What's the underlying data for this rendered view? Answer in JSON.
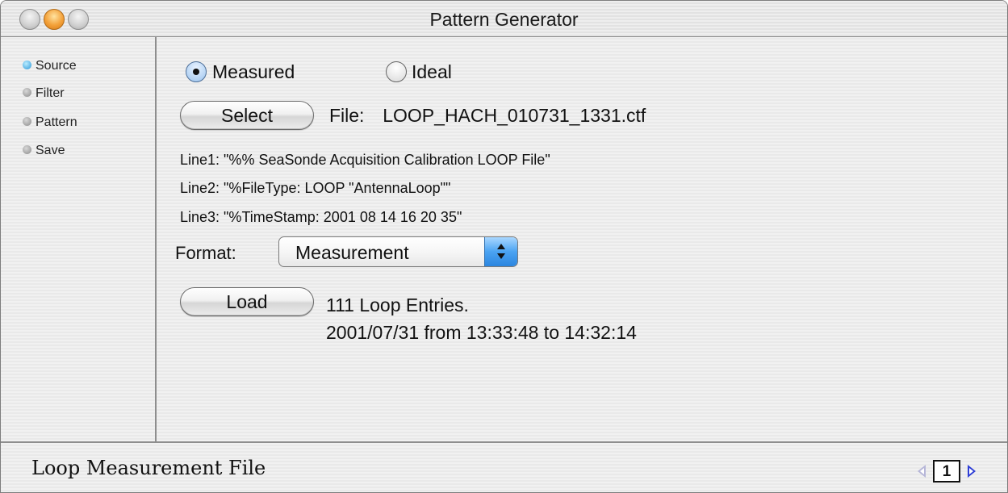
{
  "window": {
    "title": "Pattern Generator"
  },
  "sidebar": {
    "items": [
      {
        "label": "Source",
        "active": true
      },
      {
        "label": "Filter",
        "active": false
      },
      {
        "label": "Pattern",
        "active": false
      },
      {
        "label": "Save",
        "active": false
      }
    ]
  },
  "source": {
    "mode": {
      "options": [
        "Measured",
        "Ideal"
      ],
      "selected": "Measured"
    },
    "select_button": "Select",
    "file_prefix": "File:",
    "file_name": "LOOP_HACH_010731_1331.ctf",
    "header_lines": [
      "Line1: \"%% SeaSonde Acquisition Calibration LOOP File\"",
      "Line2: \"%FileType: LOOP \"AntennaLoop\"\"",
      "Line3: \"%TimeStamp: 2001 08 14  16 20 35\""
    ],
    "format_label": "Format:",
    "format_value": "Measurement",
    "load_button": "Load",
    "load_summary": "111 Loop Entries.",
    "load_range": "2001/07/31 from 13:33:48 to 14:32:14"
  },
  "status": {
    "title": "Loop Measurement File",
    "page": "1"
  },
  "colors": {
    "active_dot": "#2c97d8",
    "inactive_dot": "#8b8b8b",
    "popup_arrows": "#4aa3f2",
    "pager_next": "#2e3ed6"
  }
}
